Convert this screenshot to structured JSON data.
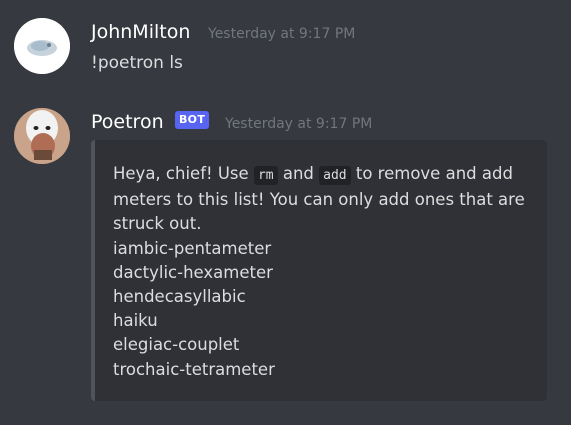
{
  "messages": [
    {
      "username": "JohnMilton",
      "timestamp": "Yesterday at 9:17 PM",
      "text": "!poetron ls"
    },
    {
      "username": "Poetron",
      "bot_tag": "BOT",
      "timestamp": "Yesterday at 9:17 PM",
      "embed": {
        "intro_1": "Heya, chief! Use ",
        "code_rm": "rm",
        "intro_2": " and ",
        "code_add": "add",
        "intro_3": " to remove and add",
        "intro_line2": "meters to this list! You can only add ones that are",
        "intro_line3": "struck out.",
        "meters": [
          "iambic-pentameter",
          "dactylic-hexameter",
          "hendecasyllabic",
          "haiku",
          "elegiac-couplet",
          "trochaic-tetrameter"
        ]
      }
    }
  ],
  "colors": {
    "background": "#36393f",
    "embed_background": "#2f3136",
    "bot_tag": "#5865f2",
    "timestamp": "#72767d"
  }
}
